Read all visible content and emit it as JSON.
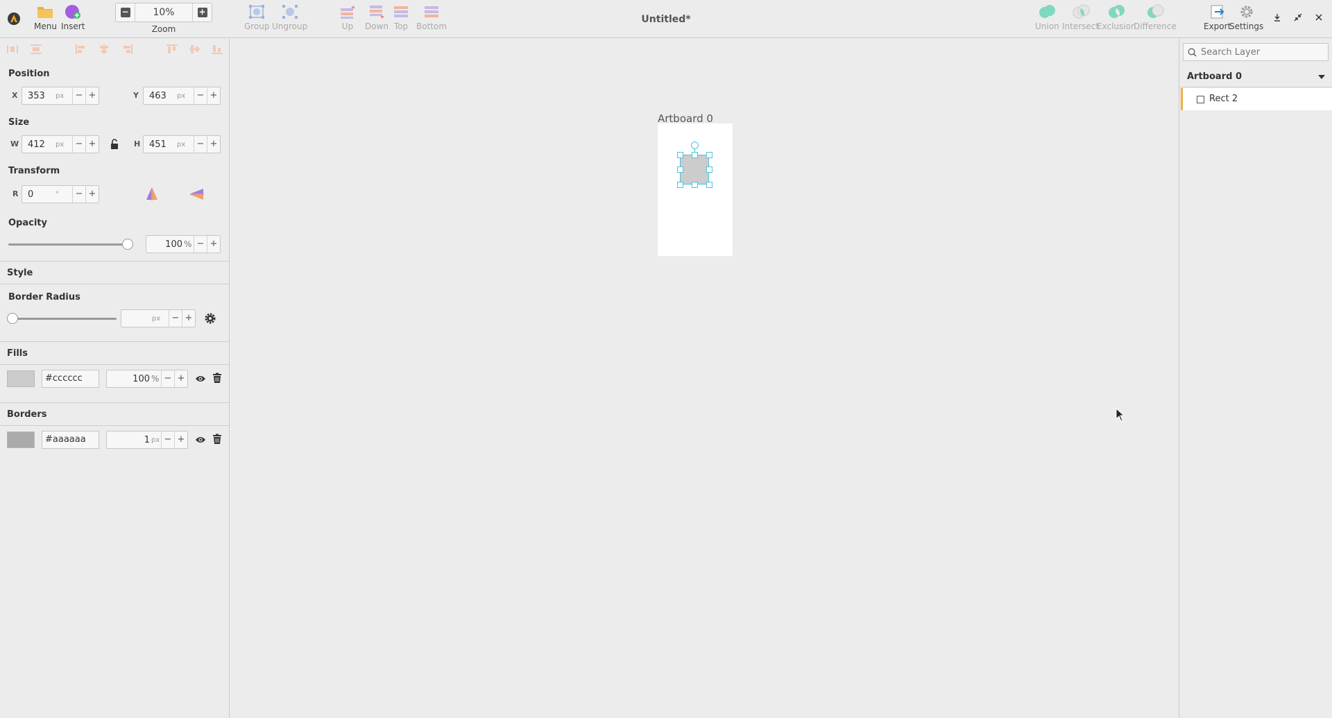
{
  "header": {
    "menu_label": "Menu",
    "insert_label": "Insert",
    "zoom_value": "10%",
    "zoom_label": "Zoom",
    "group_label": "Group",
    "ungroup_label": "Ungroup",
    "up_label": "Up",
    "down_label": "Down",
    "top_label": "Top",
    "bottom_label": "Bottom",
    "title": "Untitled*",
    "union_label": "Union",
    "intersect_label": "Intersect",
    "exclusion_label": "Exclusion",
    "difference_label": "Difference",
    "export_label": "Export",
    "settings_label": "Settings"
  },
  "inspector": {
    "position": {
      "title": "Position",
      "x_label": "X",
      "x": "353",
      "y_label": "Y",
      "y": "463",
      "unit": "px"
    },
    "size": {
      "title": "Size",
      "w_label": "W",
      "w": "412",
      "h_label": "H",
      "h": "451",
      "unit": "px"
    },
    "transform": {
      "title": "Transform",
      "r_label": "R",
      "r": "0",
      "unit": "°"
    },
    "opacity": {
      "title": "Opacity",
      "value": "100",
      "unit": "%",
      "level": 1.0
    },
    "style": {
      "title": "Style"
    },
    "border_radius": {
      "title": "Border Radius",
      "value": "",
      "unit": "px",
      "level": 0.0
    },
    "fills": {
      "title": "Fills",
      "color": "#cccccc",
      "opacity": "100",
      "unit": "%"
    },
    "borders": {
      "title": "Borders",
      "color": "#aaaaaa",
      "width": "1",
      "unit": "px"
    }
  },
  "canvas": {
    "artboard_name": "Artboard 0",
    "rect_fill": "#cccccc",
    "rect_border": "#aaaaaa",
    "selection_color": "#4fc1d9"
  },
  "layers": {
    "search_placeholder": "Search Layer",
    "artboard": "Artboard 0",
    "items": [
      {
        "name": "Rect 2"
      }
    ],
    "selected_accent": "#f0b03c"
  }
}
